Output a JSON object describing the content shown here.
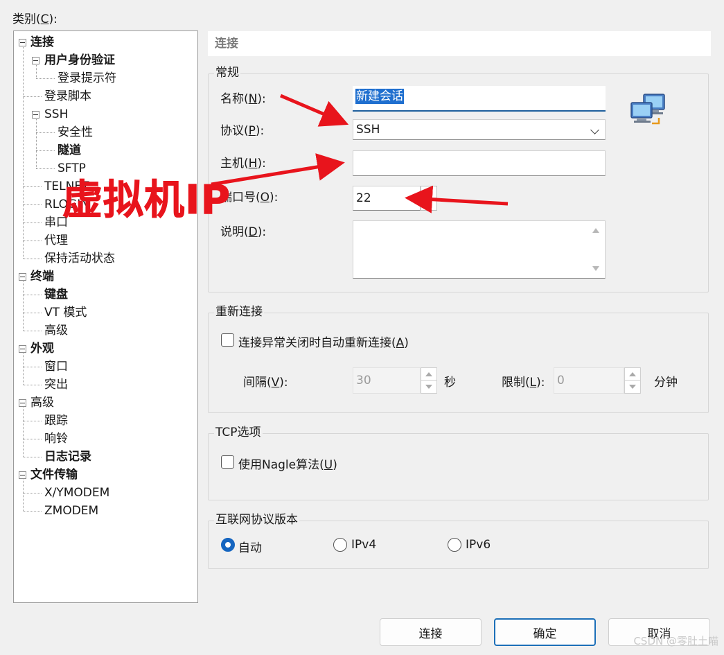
{
  "category": {
    "label": "类别(",
    "key": "C",
    "suffix": "):"
  },
  "tree": {
    "items": [
      {
        "label": "连接",
        "bold": true,
        "level": 0,
        "toggle": true
      },
      {
        "label": "用户身份验证",
        "bold": true,
        "level": 1,
        "toggle": true
      },
      {
        "label": "登录提示符",
        "bold": false,
        "level": 2
      },
      {
        "label": "登录脚本",
        "bold": false,
        "level": 1
      },
      {
        "label": "SSH",
        "bold": false,
        "level": 1,
        "toggle": true
      },
      {
        "label": "安全性",
        "bold": false,
        "level": 2
      },
      {
        "label": "隧道",
        "bold": true,
        "level": 2
      },
      {
        "label": "SFTP",
        "bold": false,
        "level": 2
      },
      {
        "label": "TELNET",
        "bold": false,
        "level": 1
      },
      {
        "label": "RLOGIN",
        "bold": false,
        "level": 1
      },
      {
        "label": "串口",
        "bold": false,
        "level": 1
      },
      {
        "label": "代理",
        "bold": false,
        "level": 1
      },
      {
        "label": "保持活动状态",
        "bold": false,
        "level": 1
      },
      {
        "label": "终端",
        "bold": true,
        "level": 0,
        "toggle": true
      },
      {
        "label": "键盘",
        "bold": true,
        "level": 1
      },
      {
        "label": "VT 模式",
        "bold": false,
        "level": 1
      },
      {
        "label": "高级",
        "bold": false,
        "level": 1
      },
      {
        "label": "外观",
        "bold": true,
        "level": 0,
        "toggle": true
      },
      {
        "label": "窗口",
        "bold": false,
        "level": 1
      },
      {
        "label": "突出",
        "bold": false,
        "level": 1
      },
      {
        "label": "高级",
        "bold": false,
        "level": 0,
        "toggle": true
      },
      {
        "label": "跟踪",
        "bold": false,
        "level": 1
      },
      {
        "label": "响铃",
        "bold": false,
        "level": 1
      },
      {
        "label": "日志记录",
        "bold": true,
        "level": 1
      },
      {
        "label": "文件传输",
        "bold": true,
        "level": 0,
        "toggle": true
      },
      {
        "label": "X/YMODEM",
        "bold": false,
        "level": 1
      },
      {
        "label": "ZMODEM",
        "bold": false,
        "level": 1
      }
    ]
  },
  "header": {
    "title": "连接"
  },
  "general": {
    "title": "常规",
    "name_label": {
      "text": "名称(",
      "key": "N",
      "suffix": "):"
    },
    "name_value": "新建会话",
    "protocol_label": {
      "text": "协议(",
      "key": "P",
      "suffix": "):"
    },
    "protocol_value": "SSH",
    "host_label": {
      "text": "主机(",
      "key": "H",
      "suffix": "):"
    },
    "host_value": "",
    "port_label": {
      "text": "端口号(",
      "key": "O",
      "suffix": "):"
    },
    "port_value": "22",
    "desc_label": {
      "text": "说明(",
      "key": "D",
      "suffix": "):"
    }
  },
  "reconnect": {
    "title": "重新连接",
    "checkbox_label": {
      "text": "连接异常关闭时自动重新连接(",
      "key": "A",
      "suffix": ")"
    },
    "interval_label": {
      "text": "间隔(",
      "key": "V",
      "suffix": "):"
    },
    "interval_value": "30",
    "interval_unit": "秒",
    "limit_label": {
      "text": "限制(",
      "key": "L",
      "suffix": "):"
    },
    "limit_value": "0",
    "limit_unit": "分钟"
  },
  "tcp": {
    "title": "TCP选项",
    "nagle_label": {
      "text": "使用Nagle算法(",
      "key": "U",
      "suffix": ")"
    }
  },
  "ip_version": {
    "title": "互联网协议版本",
    "options": [
      "自动",
      "IPv4",
      "IPv6"
    ],
    "selected": "自动"
  },
  "buttons": {
    "connect": "连接",
    "ok": "确定",
    "cancel": "取消"
  },
  "annotation": {
    "text": "虚拟机IP",
    "color": "#e8141c"
  },
  "watermark": "CSDN @零肚土喵"
}
